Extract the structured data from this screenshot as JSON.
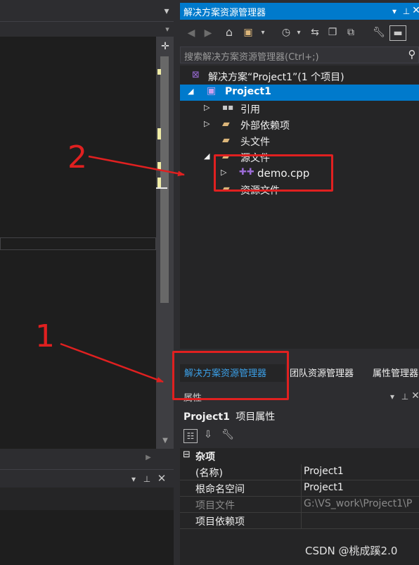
{
  "editor": {
    "dropdown_icon": "chevron-down-icon",
    "split_icon": "split-icon"
  },
  "solution_explorer": {
    "title": "解决方案资源管理器",
    "search_placeholder": "搜索解决方案资源管理器(Ctrl+;)",
    "tree": {
      "solution": "解决方案“Project1”(1 个项目)",
      "project": "Project1",
      "items": [
        {
          "label": "引用",
          "icon": "references-icon",
          "expandable": true
        },
        {
          "label": "外部依赖项",
          "icon": "external-deps-icon",
          "expandable": true
        },
        {
          "label": "头文件",
          "icon": "folder-icon",
          "expandable": false
        },
        {
          "label": "源文件",
          "icon": "folder-open-icon",
          "expandable": true
        },
        {
          "label": "demo.cpp",
          "icon": "cpp-file-icon",
          "expandable": true
        },
        {
          "label": "资源文件",
          "icon": "folder-icon",
          "expandable": false
        }
      ]
    },
    "tabs": [
      "解决方案资源管理器",
      "团队资源管理器",
      "属性管理器"
    ]
  },
  "properties": {
    "title": "属性",
    "object_name": "Project1",
    "object_type": "项目属性",
    "category": "杂项",
    "rows": [
      {
        "name": "(名称)",
        "value": "Project1",
        "muted": false
      },
      {
        "name": "根命名空间",
        "value": "Project1",
        "muted": false
      },
      {
        "name": "项目文件",
        "value": "G:\\VS_work\\Project1\\P",
        "muted": true
      },
      {
        "name": "项目依赖项",
        "value": "",
        "muted": false
      }
    ]
  },
  "annotations": {
    "label_1": "1",
    "label_2": "2",
    "color": "#e02020"
  },
  "watermark": "CSDN @桃成蹊2.0",
  "colors": {
    "accent": "#007acc",
    "background": "#2d2d30",
    "panel": "#252526"
  }
}
